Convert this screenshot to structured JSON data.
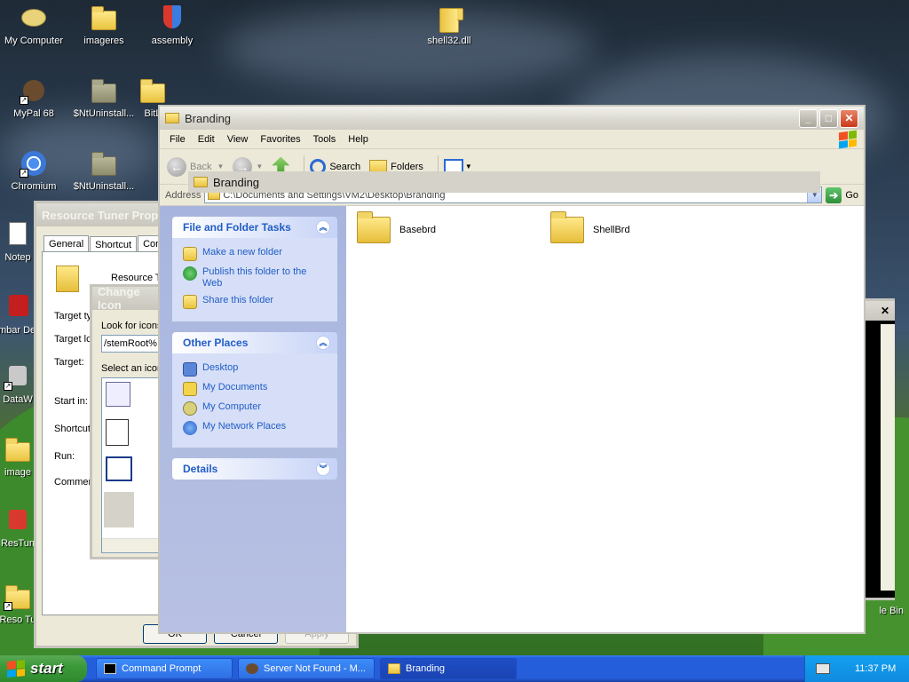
{
  "desktop": {
    "icons": [
      {
        "label": "My Computer"
      },
      {
        "label": "imageres"
      },
      {
        "label": "assembly"
      },
      {
        "label": "shell32.dll"
      },
      {
        "label": "MyPal 68"
      },
      {
        "label": "$NtUninstall..."
      },
      {
        "label": "BitL"
      },
      {
        "label": "Chromium"
      },
      {
        "label": "$NtUninstall..."
      },
      {
        "label": "Notep"
      },
      {
        "label": "Embar Dev-"
      },
      {
        "label": "DataW"
      },
      {
        "label": "image"
      },
      {
        "label": "ResTun"
      },
      {
        "label": "Reso Tu"
      },
      {
        "label": "le Bin"
      }
    ]
  },
  "branding_window": {
    "title": "Branding",
    "menu": [
      "File",
      "Edit",
      "View",
      "Favorites",
      "Tools",
      "Help"
    ],
    "toolbar": {
      "back": "Back",
      "search": "Search",
      "folders": "Folders"
    },
    "address_label": "Address",
    "address_value": "C:\\Documents and Settings\\VM2\\Desktop\\Branding",
    "go_label": "Go",
    "tooltip_title": "Branding",
    "tasks": {
      "header": "File and Folder Tasks",
      "items": [
        "Make a new folder",
        "Publish this folder to the Web",
        "Share this folder"
      ]
    },
    "other_places": {
      "header": "Other Places",
      "items": [
        "Desktop",
        "My Documents",
        "My Computer",
        "My Network Places"
      ]
    },
    "details": {
      "header": "Details"
    },
    "folders": [
      "Basebrd",
      "ShellBrd"
    ]
  },
  "rt_properties": {
    "title": "Resource Tuner Prope",
    "tabs": [
      "General",
      "Shortcut",
      "Com"
    ],
    "labels": {
      "name": "Resource T",
      "target_type": "Target ty",
      "target_location": "Target lc",
      "target": "Target:",
      "start_in": "Start in:",
      "shortcut": "Shortcut",
      "run": "Run:",
      "comment": "Commen"
    },
    "buttons": [
      "OK",
      "Cancel",
      "Apply"
    ]
  },
  "change_icon": {
    "title": "Change Icon",
    "look_for": "Look for icons",
    "path_value": "/stemRoot%",
    "select_label": "Select an icon"
  },
  "taskbar": {
    "start_label": "start",
    "tasks": [
      "Command Prompt",
      "Server Not Found - M...",
      "Branding"
    ],
    "clock": "11:37 PM"
  }
}
